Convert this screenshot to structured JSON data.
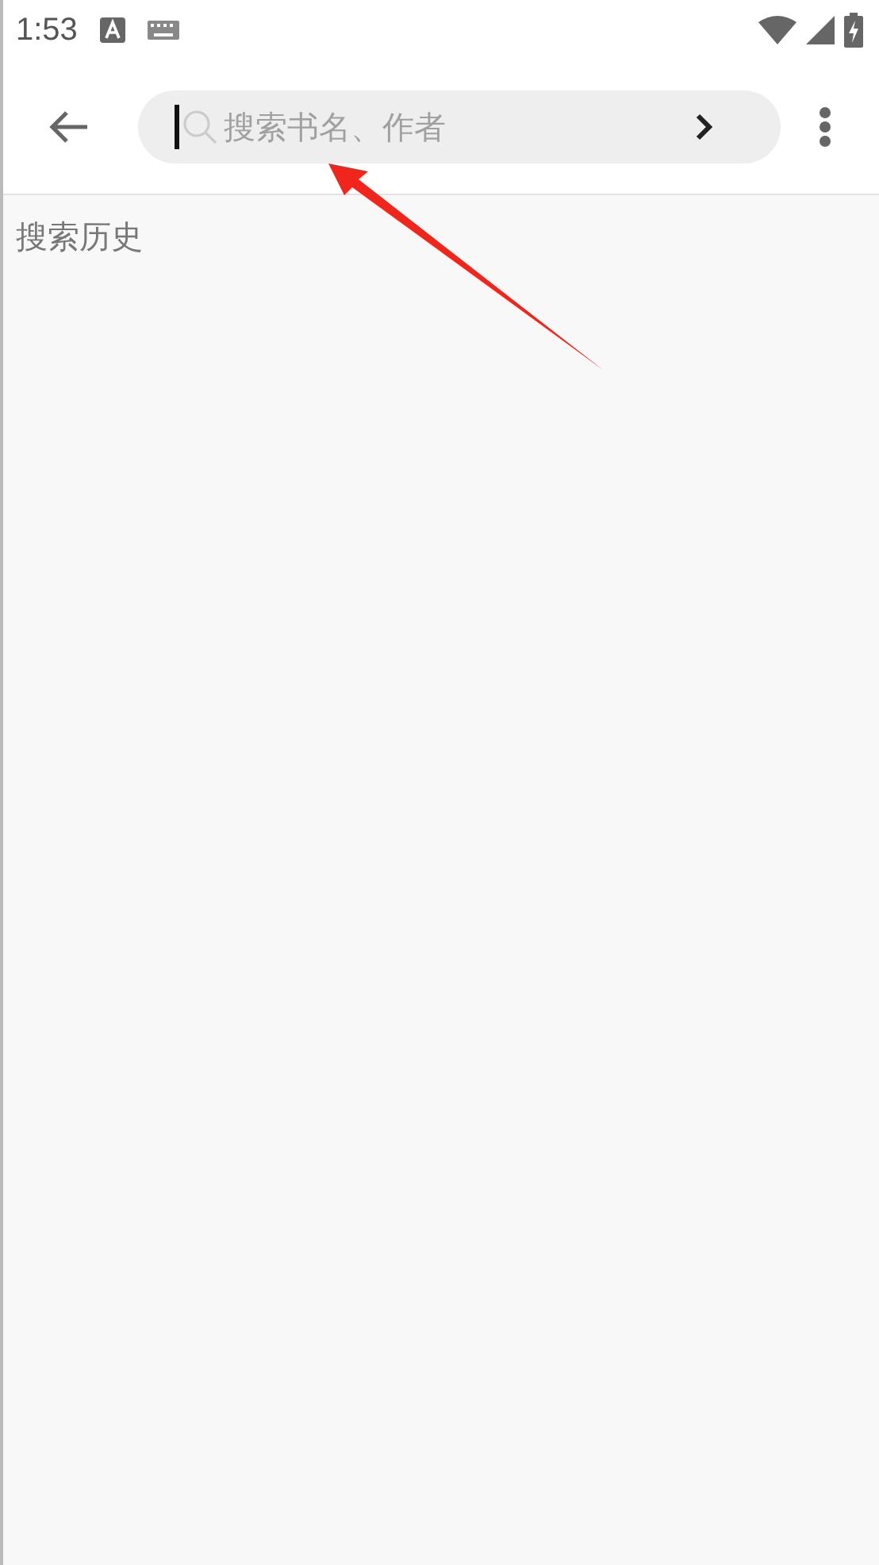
{
  "status_bar": {
    "time": "1:53"
  },
  "search": {
    "placeholder": "搜索书名、作者"
  },
  "history": {
    "title": "搜索历史"
  }
}
